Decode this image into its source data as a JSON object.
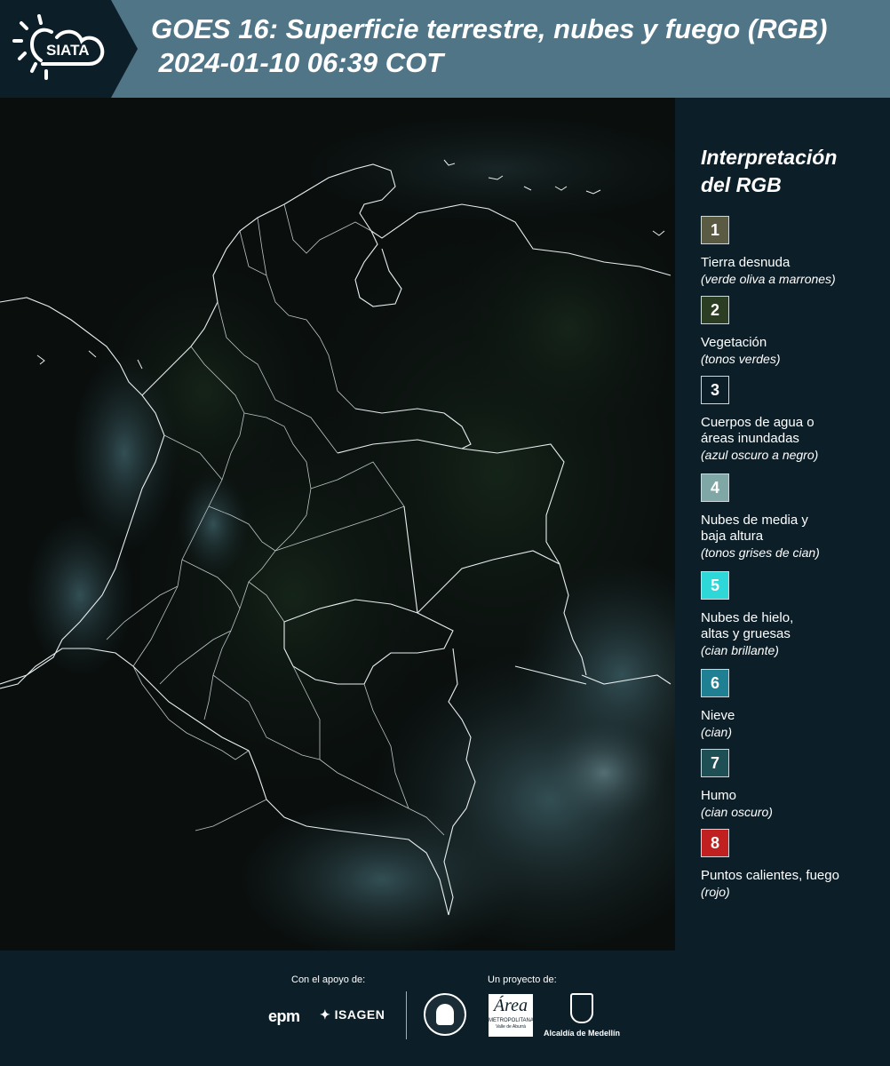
{
  "header": {
    "logo_text": "SIATA",
    "title_line1": "GOES 16: Superficie terrestre, nubes y fuego (RGB)",
    "title_line2": " 2024-01-10 06:39 COT"
  },
  "legend": {
    "title": "Interpretación\ndel RGB",
    "items": [
      {
        "num": "1",
        "color": "#5b5a43",
        "label": "Tierra desnuda",
        "desc": "(verde oliva a marrones)"
      },
      {
        "num": "2",
        "color": "#2b3d22",
        "label": "Vegetación",
        "desc": "(tonos verdes)"
      },
      {
        "num": "3",
        "color": "#0c1f29",
        "label": "Cuerpos de agua o\náreas inundadas",
        "desc": "(azul oscuro a negro)"
      },
      {
        "num": "4",
        "color": "#7fa7a5",
        "label": "Nubes de media y\nbaja altura",
        "desc": "(tonos grises de cian)"
      },
      {
        "num": "5",
        "color": "#2fd8d8",
        "label": "Nubes de hielo,\naltas y gruesas",
        "desc": "(cian brillante)"
      },
      {
        "num": "6",
        "color": "#1f7f93",
        "label": "Nieve",
        "desc": "(cian)"
      },
      {
        "num": "7",
        "color": "#1e4f55",
        "label": "Humo",
        "desc": "(cian oscuro)"
      },
      {
        "num": "8",
        "color": "#c0201f",
        "label": "Puntos calientes, fuego",
        "desc": "(rojo)"
      }
    ]
  },
  "footer": {
    "support_label": "Con el apoyo de:",
    "project_label": "Un proyecto de:",
    "logos": {
      "epm": "epm",
      "isagen": "ISAGEN",
      "area_title": "Área",
      "area_sub": "METROPOLITANA",
      "area_sub2": "Valle de Aburrá",
      "medellin": "Alcaldía de Medellín"
    }
  }
}
